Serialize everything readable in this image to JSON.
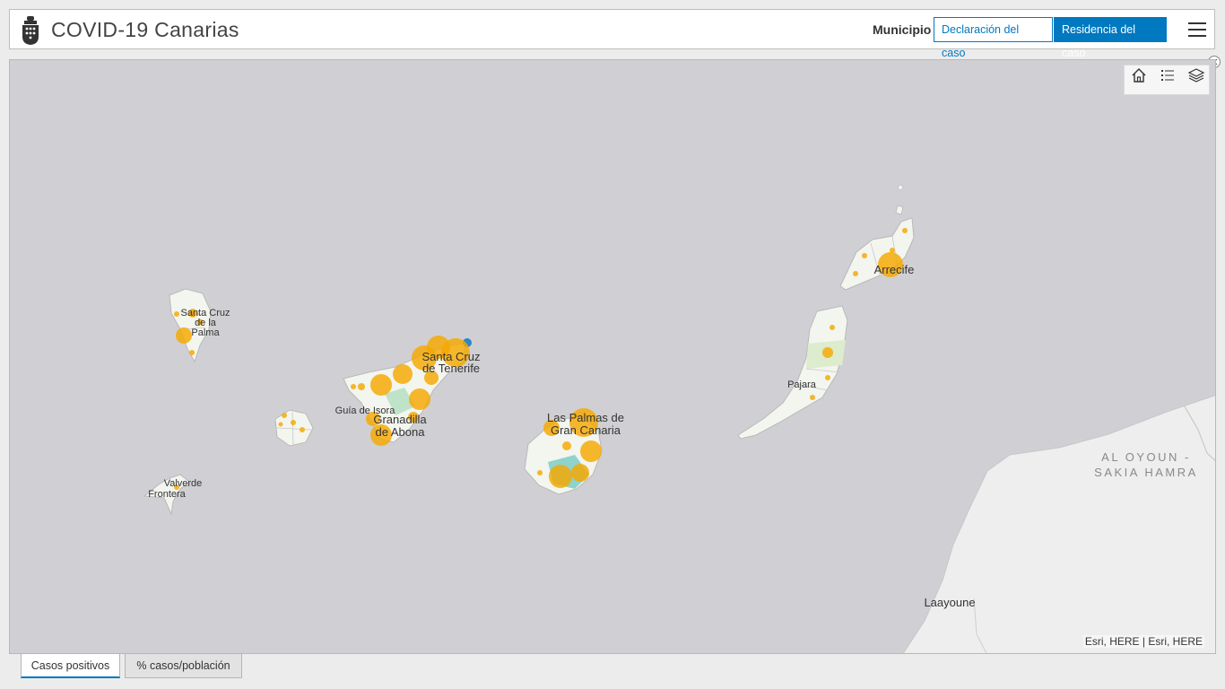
{
  "header": {
    "title": "COVID-19 Canarias",
    "municipio_label": "Municipio",
    "buttons": {
      "declaracion": "Declaración del caso",
      "residencia": "Residencia del caso"
    }
  },
  "map": {
    "labels": {
      "santa_cruz_palma_1": "Santa Cruz",
      "santa_cruz_palma_2": "de la",
      "santa_cruz_palma_3": "Palma",
      "valverde": "Valverde",
      "frontera": "Frontera",
      "guia_de_isora": "Guía de Isora",
      "granadilla_1": "Granadilla",
      "granadilla_2": "de Abona",
      "santa_cruz_tenerife_1": "Santa Cruz",
      "santa_cruz_tenerife_2": "de Tenerife",
      "las_palmas_1": "Las Palmas de",
      "las_palmas_2": "Gran Canaria",
      "arrecife": "Arrecife",
      "pajara": "Pajara",
      "al_oyoun_1": "AL OYOUN -",
      "al_oyoun_2": "SAKIA HAMRA",
      "laayoune": "Laayoune"
    },
    "attribution": "Esri, HERE | Esri, HERE",
    "tools": [
      "home-icon",
      "legend-list-icon",
      "layers-icon"
    ],
    "colors": {
      "water": "#d0d0d4",
      "land": "#f3f5ef",
      "bubble": "#f5a800",
      "accent": "#0079c1"
    }
  },
  "tabs": [
    {
      "label": "Casos positivos",
      "active": true
    },
    {
      "label": "% casos/población",
      "active": false
    }
  ]
}
